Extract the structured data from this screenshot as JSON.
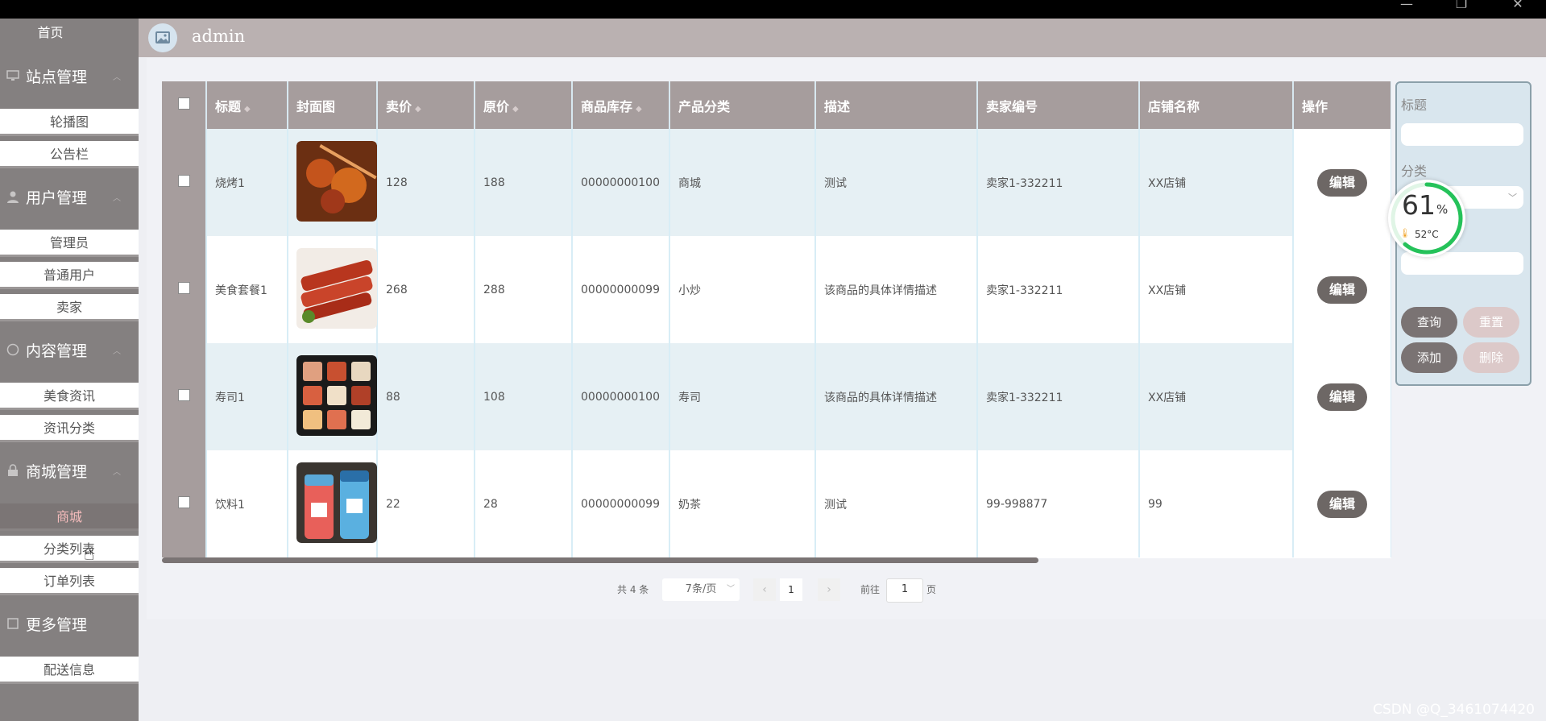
{
  "window": {
    "minimize": "—",
    "maximize": "❐",
    "close": "✕"
  },
  "sidebar": {
    "home": "首页",
    "groups": [
      {
        "label": "站点管理",
        "items": [
          "轮播图",
          "公告栏"
        ]
      },
      {
        "label": "用户管理",
        "items": [
          "管理员",
          "普通用户",
          "卖家"
        ]
      },
      {
        "label": "内容管理",
        "items": [
          "美食资讯",
          "资讯分类"
        ]
      },
      {
        "label": "商城管理",
        "items": [
          "商城",
          "分类列表",
          "订单列表"
        ],
        "active": "商城"
      },
      {
        "label": "更多管理",
        "items": [
          "配送信息"
        ]
      }
    ]
  },
  "header": {
    "user": "admin"
  },
  "table": {
    "columns": [
      "标题",
      "封面图",
      "卖价",
      "原价",
      "商品库存",
      "产品分类",
      "描述",
      "卖家编号",
      "店铺名称",
      "操作"
    ],
    "edit_label": "编辑",
    "rows": [
      {
        "title": "烧烤1",
        "price": "128",
        "orig": "188",
        "stock": "00000000100",
        "category": "商城",
        "desc": "测试",
        "seller": "卖家1-332211",
        "shop": "XX店铺"
      },
      {
        "title": "美食套餐1",
        "price": "268",
        "orig": "288",
        "stock": "00000000099",
        "category": "小炒",
        "desc": "该商品的具体详情描述",
        "seller": "卖家1-332211",
        "shop": "XX店铺"
      },
      {
        "title": "寿司1",
        "price": "88",
        "orig": "108",
        "stock": "00000000100",
        "category": "寿司",
        "desc": "该商品的具体详情描述",
        "seller": "卖家1-332211",
        "shop": "XX店铺"
      },
      {
        "title": "饮料1",
        "price": "22",
        "orig": "28",
        "stock": "00000000099",
        "category": "奶茶",
        "desc": "测试",
        "seller": "99-998877",
        "shop": "99"
      }
    ]
  },
  "pagination": {
    "total": "共 4 条",
    "page_size": "7条/页",
    "current": "1",
    "goto_prefix": "前往",
    "goto_value": "1",
    "goto_suffix": "页"
  },
  "filter": {
    "title_label": "标题",
    "category_label": "分类",
    "query": "查询",
    "reset": "重置",
    "add": "添加",
    "delete": "删除"
  },
  "gauge": {
    "percent": "61",
    "unit": "%",
    "temp": "52°C",
    "level": 0.61
  },
  "watermark": "CSDN @Q_3461074420"
}
